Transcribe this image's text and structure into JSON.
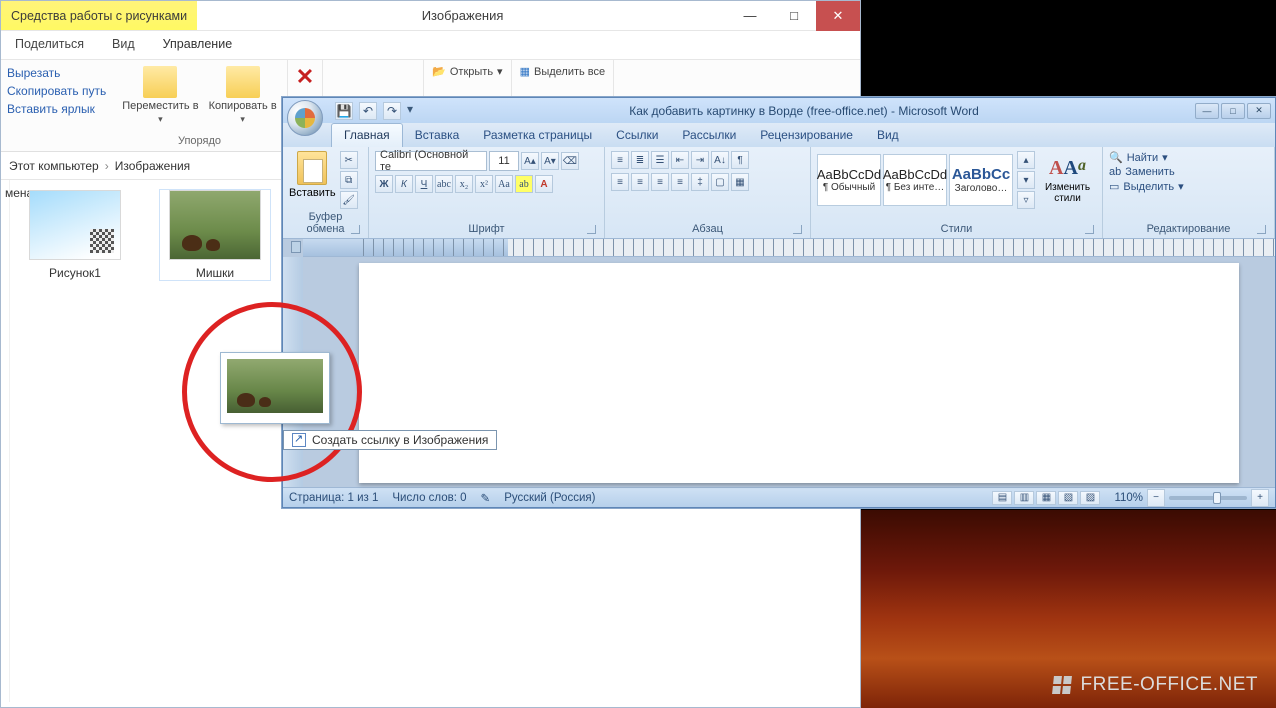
{
  "explorer": {
    "context_tab": "Средства работы с рисунками",
    "title": "Изображения",
    "menu": {
      "share": "Поделиться",
      "view": "Вид",
      "manage": "Управление"
    },
    "clipboard_links": {
      "cut": "Вырезать",
      "copy_path": "Скопировать путь",
      "paste_shortcut": "Вставить ярлык"
    },
    "ribbon": {
      "organize": {
        "move_to": "Переместить в",
        "copy_to": "Копировать в",
        "label": "Упорядо"
      },
      "delete_label": "—",
      "open_group": {
        "open": "Открыть",
        "select_all": "Выделить все"
      }
    },
    "breadcrumb": {
      "root": "Этот компьютер",
      "folder": "Изображения",
      "sidebar_label": "мена"
    },
    "files": [
      {
        "name": "Рисунок1",
        "thumb": "sky"
      },
      {
        "name": "Мишки",
        "thumb": "bear"
      }
    ]
  },
  "word": {
    "title": "Как добавить картинку в Ворде (free-office.net) - Microsoft Word",
    "tabs": {
      "home": "Главная",
      "insert": "Вставка",
      "layout": "Разметка страницы",
      "references": "Ссылки",
      "mailings": "Рассылки",
      "review": "Рецензирование",
      "view": "Вид"
    },
    "ribbon": {
      "clipboard": {
        "paste": "Вставить",
        "label": "Буфер обмена"
      },
      "font": {
        "name": "Calibri (Основной те",
        "size": "11",
        "label": "Шрифт"
      },
      "paragraph": {
        "label": "Абзац"
      },
      "styles": {
        "preview_text": "AaBbCcDd",
        "heading_preview": "AaBbCc",
        "normal": "¶ Обычный",
        "no_spacing": "¶ Без инте…",
        "heading1": "Заголово…",
        "change": "Изменить стили",
        "label": "Стили"
      },
      "editing": {
        "find": "Найти",
        "replace": "Заменить",
        "select": "Выделить",
        "label": "Редактирование"
      }
    },
    "status": {
      "page": "Страница: 1 из 1",
      "words": "Число слов: 0",
      "language": "Русский (Россия)",
      "zoom": "110%"
    }
  },
  "drag_tooltip": "Создать ссылку в Изображения",
  "watermark": "FREE-OFFICE.NET"
}
